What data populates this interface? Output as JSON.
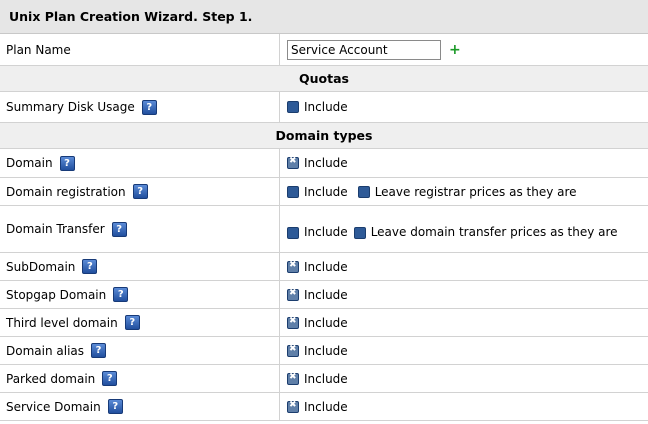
{
  "title": "Unix Plan Creation Wizard. Step 1.",
  "plan_name": {
    "label": "Plan Name",
    "value": "Service Account"
  },
  "quotas": {
    "header": "Quotas",
    "summary_disk_usage": {
      "label": "Summary Disk Usage",
      "include_label": "Include"
    }
  },
  "domain_types": {
    "header": "Domain types",
    "items": [
      {
        "label": "Domain",
        "include_label": "Include",
        "checked": true
      },
      {
        "label": "Domain registration",
        "include_label": "Include",
        "checked": false,
        "extra_label": "Leave registrar prices as they are"
      },
      {
        "label": "Domain Transfer",
        "include_label": "Include",
        "checked": false,
        "extra_label": "Leave domain transfer prices as they are"
      },
      {
        "label": "SubDomain",
        "include_label": "Include",
        "checked": true
      },
      {
        "label": "Stopgap Domain",
        "include_label": "Include",
        "checked": true
      },
      {
        "label": "Third level domain",
        "include_label": "Include",
        "checked": true
      },
      {
        "label": "Domain alias",
        "include_label": "Include",
        "checked": true
      },
      {
        "label": "Parked domain",
        "include_label": "Include",
        "checked": true
      },
      {
        "label": "Service Domain",
        "include_label": "Include",
        "checked": true
      }
    ]
  },
  "help_glyph": "?",
  "add_glyph": "+"
}
